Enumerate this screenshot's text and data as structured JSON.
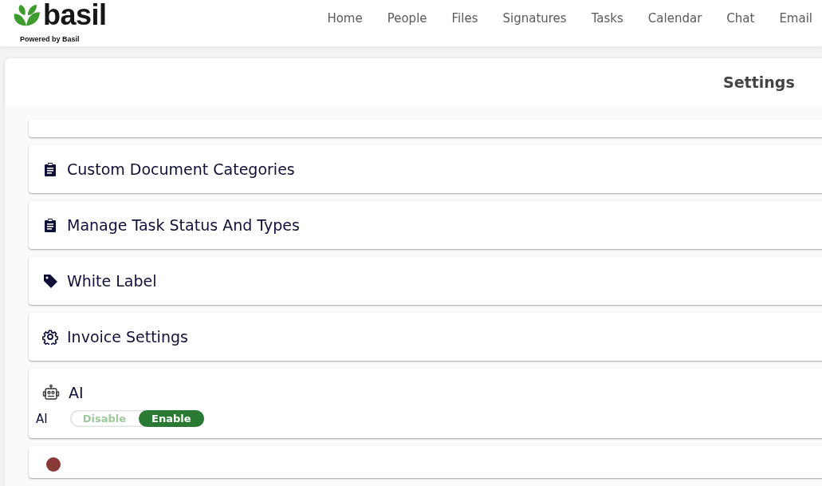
{
  "brand": {
    "name": "basil",
    "tagline": "Powered by Basil"
  },
  "nav": [
    {
      "label": "Home"
    },
    {
      "label": "People"
    },
    {
      "label": "Files"
    },
    {
      "label": "Signatures"
    },
    {
      "label": "Tasks"
    },
    {
      "label": "Calendar"
    },
    {
      "label": "Chat"
    },
    {
      "label": "Email"
    }
  ],
  "page": {
    "title": "Settings"
  },
  "sections": [
    {
      "kind": "clipboard",
      "title": "Custom Document Categories"
    },
    {
      "kind": "clipboard",
      "title": "Manage Task Status And Types"
    },
    {
      "kind": "tag",
      "title": "White Label"
    },
    {
      "kind": "gear",
      "title": "Invoice Settings"
    },
    {
      "kind": "robot",
      "title": "AI",
      "setting": {
        "label": "AI",
        "options": [
          {
            "label": "Disable",
            "selected": false
          },
          {
            "label": "Enable",
            "selected": true
          }
        ]
      }
    }
  ]
}
